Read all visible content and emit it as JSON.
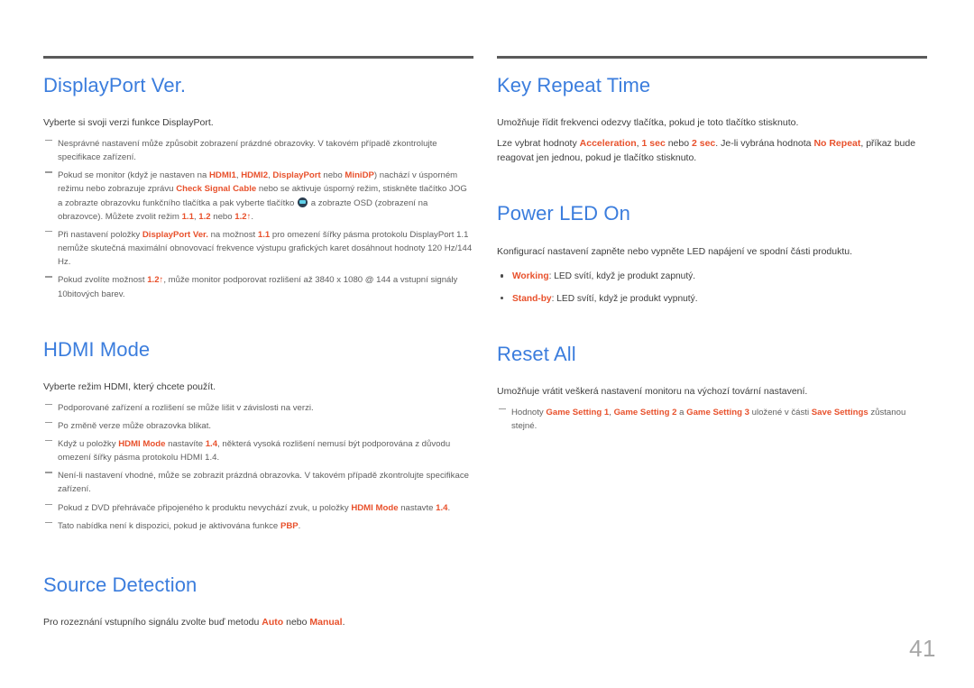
{
  "colors": {
    "heading": "#3b7ddd",
    "highlight": "#e8512c",
    "rule": "#5a5a5a",
    "body": "#3d3d3d",
    "note": "#5f5f5f",
    "page_number": "#a7a7a7"
  },
  "page_number": "41",
  "left_column": {
    "sections": [
      {
        "id": "displayport-ver",
        "title": "DisplayPort Ver.",
        "lead": "Vyberte si svoji verzi funkce DisplayPort.",
        "notes": [
          {
            "id": "dp-note-1",
            "parts": [
              {
                "t": "Nesprávné nastavení může způsobit zobrazení prázdné obrazovky. V takovém případě zkontrolujte specifikace zařízení.",
                "hl": false
              }
            ]
          },
          {
            "id": "dp-note-2",
            "parts": [
              {
                "t": "Pokud se monitor (když je nastaven na ",
                "hl": false
              },
              {
                "t": "HDMI1",
                "hl": true
              },
              {
                "t": ", ",
                "hl": false
              },
              {
                "t": "HDMI2",
                "hl": true
              },
              {
                "t": ", ",
                "hl": false
              },
              {
                "t": "DisplayPort",
                "hl": true
              },
              {
                "t": " nebo ",
                "hl": false
              },
              {
                "t": "MiniDP",
                "hl": true
              },
              {
                "t": ") nachází v úsporném režimu nebo zobrazuje zprávu ",
                "hl": false
              },
              {
                "t": "Check Signal Cable",
                "hl": true
              },
              {
                "t": " nebo se aktivuje úsporný režim, stiskněte tlačítko JOG a zobrazte obrazovku funkčního tlačítka a pak vyberte tlačítko ",
                "hl": false
              },
              {
                "t": "JOG_ICON",
                "icon": "jog-button-icon"
              },
              {
                "t": " a zobrazte OSD (zobrazení na obrazovce). Můžete zvolit režim ",
                "hl": false
              },
              {
                "t": "1.1",
                "hl": true
              },
              {
                "t": ", ",
                "hl": false
              },
              {
                "t": "1.2",
                "hl": true
              },
              {
                "t": " nebo ",
                "hl": false
              },
              {
                "t": "1.2↑",
                "hl": true
              },
              {
                "t": ".",
                "hl": false
              }
            ]
          },
          {
            "id": "dp-note-3",
            "parts": [
              {
                "t": "Při nastavení položky ",
                "hl": false
              },
              {
                "t": "DisplayPort Ver.",
                "hl": true
              },
              {
                "t": " na možnost ",
                "hl": false
              },
              {
                "t": "1.1",
                "hl": true
              },
              {
                "t": " pro omezení šířky pásma protokolu DisplayPort 1.1 nemůže skutečná maximální obnovovací frekvence výstupu grafických karet dosáhnout hodnoty 120 Hz/144 Hz.",
                "hl": false
              }
            ]
          },
          {
            "id": "dp-note-4",
            "parts": [
              {
                "t": "Pokud zvolíte možnost ",
                "hl": false
              },
              {
                "t": "1.2↑",
                "hl": true
              },
              {
                "t": ", může monitor podporovat rozlišení až 3840 x 1080 @ 144 a vstupní signály 10bitových barev.",
                "hl": false
              }
            ]
          }
        ]
      },
      {
        "id": "hdmi-mode",
        "title": "HDMI Mode",
        "lead": "Vyberte režim HDMI, který chcete použít.",
        "notes": [
          {
            "id": "hdmi-note-1",
            "parts": [
              {
                "t": "Podporované zařízení a rozlišení se může lišit v závislosti na verzi.",
                "hl": false
              }
            ]
          },
          {
            "id": "hdmi-note-2",
            "parts": [
              {
                "t": "Po změně verze může obrazovka blikat.",
                "hl": false
              }
            ]
          },
          {
            "id": "hdmi-note-3",
            "parts": [
              {
                "t": "Když u položky ",
                "hl": false
              },
              {
                "t": "HDMI Mode",
                "hl": true
              },
              {
                "t": " nastavíte ",
                "hl": false
              },
              {
                "t": "1.4",
                "hl": true
              },
              {
                "t": ", některá vysoká rozlišení nemusí být podporována z důvodu omezení šířky pásma protokolu HDMI 1.4.",
                "hl": false
              }
            ]
          },
          {
            "id": "hdmi-note-4",
            "parts": [
              {
                "t": "Není-li nastavení vhodné, může se zobrazit prázdná obrazovka. V takovém případě zkontrolujte specifikace zařízení.",
                "hl": false
              }
            ]
          },
          {
            "id": "hdmi-note-5",
            "parts": [
              {
                "t": "Pokud z DVD přehrávače připojeného k produktu nevychází zvuk, u položky ",
                "hl": false
              },
              {
                "t": "HDMI Mode",
                "hl": true
              },
              {
                "t": " nastavte ",
                "hl": false
              },
              {
                "t": "1.4",
                "hl": true
              },
              {
                "t": ".",
                "hl": false
              }
            ]
          },
          {
            "id": "hdmi-note-6",
            "parts": [
              {
                "t": "Tato nabídka není k dispozici, pokud je aktivována funkce ",
                "hl": false
              },
              {
                "t": "PBP",
                "hl": true
              },
              {
                "t": ".",
                "hl": false
              }
            ]
          }
        ]
      },
      {
        "id": "source-detection",
        "title": "Source Detection",
        "lead_parts": [
          {
            "t": "Pro rozeznání vstupního signálu zvolte buď metodu ",
            "hl": false
          },
          {
            "t": "Auto",
            "hl": true
          },
          {
            "t": " nebo ",
            "hl": false
          },
          {
            "t": "Manual",
            "hl": true
          },
          {
            "t": ".",
            "hl": false
          }
        ],
        "notes": []
      }
    ]
  },
  "right_column": {
    "sections": [
      {
        "id": "key-repeat-time",
        "title": "Key Repeat Time",
        "lead": "Umožňuje řídit frekvenci odezvy tlačítka, pokud je toto tlačítko stisknuto.",
        "lead2_parts": [
          {
            "t": "Lze vybrat hodnoty ",
            "hl": false
          },
          {
            "t": "Acceleration",
            "hl": true
          },
          {
            "t": ", ",
            "hl": false
          },
          {
            "t": "1 sec",
            "hl": true
          },
          {
            "t": " nebo ",
            "hl": false
          },
          {
            "t": "2 sec",
            "hl": true
          },
          {
            "t": ". Je-li vybrána hodnota ",
            "hl": false
          },
          {
            "t": "No Repeat",
            "hl": true
          },
          {
            "t": ", příkaz bude reagovat jen jednou, pokud je tlačítko stisknuto.",
            "hl": false
          }
        ]
      },
      {
        "id": "power-led-on",
        "title": "Power LED On",
        "lead": "Konfigurací nastavení zapněte nebo vypněte LED napájení ve spodní části produktu.",
        "bullets": [
          {
            "id": "power-led-bullet-working",
            "parts": [
              {
                "t": "Working",
                "hl": true
              },
              {
                "t": ": LED svítí, když je produkt zapnutý.",
                "hl": false
              }
            ]
          },
          {
            "id": "power-led-bullet-standby",
            "parts": [
              {
                "t": "Stand-by",
                "hl": true
              },
              {
                "t": ": LED svítí, když je produkt vypnutý.",
                "hl": false
              }
            ]
          }
        ]
      },
      {
        "id": "reset-all",
        "title": "Reset All",
        "lead": "Umožňuje vrátit veškerá nastavení monitoru na výchozí tovární nastavení.",
        "notes": [
          {
            "id": "reset-note-1",
            "parts": [
              {
                "t": "Hodnoty ",
                "hl": false
              },
              {
                "t": "Game Setting 1",
                "hl": true
              },
              {
                "t": ", ",
                "hl": false
              },
              {
                "t": "Game Setting 2",
                "hl": true
              },
              {
                "t": " a ",
                "hl": false
              },
              {
                "t": "Game Setting 3",
                "hl": true
              },
              {
                "t": " uložené v části ",
                "hl": false
              },
              {
                "t": "Save Settings",
                "hl": true
              },
              {
                "t": " zůstanou stejné.",
                "hl": false
              }
            ]
          }
        ]
      }
    ]
  }
}
